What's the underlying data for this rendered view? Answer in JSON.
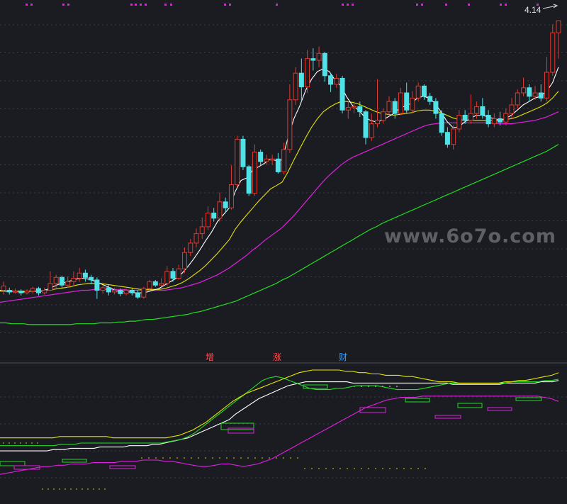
{
  "price_label": "4.14",
  "watermark": "www.6o7o.com",
  "signals": [
    "增",
    "涨",
    "财"
  ],
  "colors": {
    "background": "#1b1c22",
    "grid": "#3a3b46",
    "up": "#e0392e",
    "down": "#4fe3e8",
    "ma_short": "#ffffff",
    "ma_mid": "#e6e600",
    "ma_long": "#e020e0",
    "ma_longest": "#22dd22",
    "top_dots": "#e020e0"
  },
  "chart_data": {
    "type": "candlestick",
    "panel_top": {
      "ylim": [
        0.5,
        4.3
      ],
      "gridlines": 12,
      "candles": [
        [
          1.0,
          1.05,
          0.95,
          1.1
        ],
        [
          1.0,
          0.98,
          0.95,
          1.03
        ],
        [
          0.98,
          0.99,
          0.96,
          1.02
        ],
        [
          0.99,
          0.97,
          0.94,
          1.01
        ],
        [
          0.97,
          0.99,
          0.95,
          1.01
        ],
        [
          0.99,
          1.02,
          0.96,
          1.04
        ],
        [
          1.02,
          0.97,
          0.94,
          1.04
        ],
        [
          0.97,
          1.0,
          0.95,
          1.03
        ],
        [
          1.0,
          1.08,
          0.99,
          1.22
        ],
        [
          1.08,
          1.15,
          1.03,
          1.18
        ],
        [
          1.15,
          1.06,
          1.03,
          1.17
        ],
        [
          1.06,
          1.1,
          1.03,
          1.16
        ],
        [
          1.1,
          1.14,
          1.05,
          1.22
        ],
        [
          1.14,
          1.2,
          1.1,
          1.26
        ],
        [
          1.2,
          1.15,
          1.1,
          1.24
        ],
        [
          1.15,
          1.12,
          1.07,
          1.18
        ],
        [
          1.12,
          1.0,
          0.9,
          1.15
        ],
        [
          1.0,
          1.03,
          0.96,
          1.06
        ],
        [
          1.03,
          0.98,
          0.94,
          1.06
        ],
        [
          0.98,
          1.0,
          0.95,
          1.03
        ],
        [
          1.0,
          0.96,
          0.93,
          1.02
        ],
        [
          0.96,
          1.0,
          0.94,
          1.02
        ],
        [
          1.0,
          0.97,
          0.94,
          1.02
        ],
        [
          0.97,
          0.92,
          0.9,
          1.0
        ],
        [
          0.92,
          1.02,
          0.9,
          1.04
        ],
        [
          1.02,
          1.1,
          1.0,
          1.12
        ],
        [
          1.1,
          1.06,
          1.04,
          1.12
        ],
        [
          1.06,
          1.08,
          1.04,
          1.14
        ],
        [
          1.08,
          1.22,
          1.05,
          1.28
        ],
        [
          1.22,
          1.14,
          1.1,
          1.26
        ],
        [
          1.14,
          1.25,
          1.12,
          1.3
        ],
        [
          1.25,
          1.44,
          1.2,
          1.5
        ],
        [
          1.44,
          1.55,
          1.4,
          1.6
        ],
        [
          1.55,
          1.66,
          1.5,
          1.72
        ],
        [
          1.66,
          1.74,
          1.6,
          1.85
        ],
        [
          1.74,
          1.9,
          1.7,
          1.98
        ],
        [
          1.9,
          1.84,
          1.8,
          1.96
        ],
        [
          1.84,
          2.03,
          1.8,
          2.14
        ],
        [
          2.03,
          1.96,
          1.9,
          2.08
        ],
        [
          1.96,
          2.23,
          1.94,
          2.46
        ],
        [
          2.23,
          2.76,
          2.2,
          2.8
        ],
        [
          2.76,
          2.44,
          2.4,
          2.8
        ],
        [
          2.44,
          2.13,
          2.1,
          2.46
        ],
        [
          2.13,
          2.61,
          2.1,
          2.7
        ],
        [
          2.61,
          2.5,
          2.46,
          2.64
        ],
        [
          2.5,
          2.53,
          2.46,
          2.58
        ],
        [
          2.53,
          2.53,
          2.46,
          2.58
        ],
        [
          2.53,
          2.38,
          2.36,
          2.6
        ],
        [
          2.38,
          2.64,
          2.35,
          2.72
        ],
        [
          2.64,
          3.22,
          2.6,
          3.4
        ],
        [
          3.22,
          3.53,
          3.16,
          3.6
        ],
        [
          3.53,
          3.37,
          3.2,
          3.7
        ],
        [
          3.37,
          3.7,
          3.3,
          3.8
        ],
        [
          3.7,
          3.68,
          3.56,
          3.82
        ],
        [
          3.68,
          3.76,
          3.6,
          3.84
        ],
        [
          3.76,
          3.5,
          3.43,
          3.78
        ],
        [
          3.5,
          3.4,
          3.31,
          3.53
        ],
        [
          3.4,
          3.47,
          3.36,
          3.52
        ],
        [
          3.47,
          3.1,
          3.06,
          3.5
        ],
        [
          3.1,
          3.13,
          3.0,
          3.2
        ],
        [
          3.13,
          3.14,
          3.06,
          3.2
        ],
        [
          3.14,
          3.08,
          3.02,
          3.2
        ],
        [
          3.08,
          2.78,
          2.7,
          3.1
        ],
        [
          2.78,
          2.94,
          2.74,
          3.06
        ],
        [
          2.94,
          2.98,
          2.9,
          3.46
        ],
        [
          2.98,
          3.08,
          2.94,
          3.12
        ],
        [
          3.08,
          3.2,
          3.04,
          3.26
        ],
        [
          3.2,
          3.06,
          3.0,
          3.24
        ],
        [
          3.06,
          3.3,
          3.04,
          3.36
        ],
        [
          3.3,
          3.1,
          3.06,
          3.42
        ],
        [
          3.1,
          3.24,
          3.06,
          3.32
        ],
        [
          3.24,
          3.38,
          3.2,
          3.42
        ],
        [
          3.38,
          3.26,
          3.22,
          3.4
        ],
        [
          3.26,
          3.2,
          3.16,
          3.3
        ],
        [
          3.2,
          3.06,
          3.0,
          3.24
        ],
        [
          3.06,
          2.84,
          2.8,
          3.1
        ],
        [
          2.84,
          2.7,
          2.66,
          2.9
        ],
        [
          2.7,
          2.88,
          2.64,
          2.92
        ],
        [
          2.88,
          3.04,
          2.84,
          3.1
        ],
        [
          3.04,
          2.98,
          2.94,
          3.1
        ],
        [
          2.98,
          3.06,
          2.94,
          3.28
        ],
        [
          3.06,
          3.14,
          3.0,
          3.2
        ],
        [
          3.14,
          3.04,
          3.0,
          3.24
        ],
        [
          3.04,
          2.94,
          2.9,
          3.1
        ],
        [
          2.94,
          3.0,
          2.9,
          3.06
        ],
        [
          3.0,
          2.96,
          2.92,
          3.08
        ],
        [
          2.96,
          3.06,
          2.92,
          3.12
        ],
        [
          3.06,
          3.16,
          3.0,
          3.24
        ],
        [
          3.16,
          3.3,
          3.12,
          3.34
        ],
        [
          3.3,
          3.36,
          3.26,
          3.48
        ],
        [
          3.36,
          3.26,
          3.2,
          3.4
        ],
        [
          3.26,
          3.3,
          3.22,
          3.38
        ],
        [
          3.3,
          3.24,
          3.2,
          3.4
        ],
        [
          3.24,
          3.54,
          3.2,
          3.72
        ],
        [
          3.54,
          4.0,
          3.5,
          4.1
        ],
        [
          4.0,
          4.14,
          3.7,
          4.14
        ]
      ],
      "ma_short": [
        1.0,
        0.99,
        0.99,
        0.99,
        0.98,
        0.99,
        0.99,
        0.99,
        1.01,
        1.04,
        1.07,
        1.09,
        1.11,
        1.13,
        1.14,
        1.13,
        1.11,
        1.08,
        1.05,
        1.02,
        0.99,
        0.99,
        0.98,
        0.97,
        0.97,
        0.98,
        1.0,
        1.02,
        1.06,
        1.1,
        1.14,
        1.2,
        1.28,
        1.37,
        1.47,
        1.58,
        1.68,
        1.8,
        1.88,
        1.96,
        2.15,
        2.28,
        2.31,
        2.4,
        2.44,
        2.48,
        2.53,
        2.51,
        2.52,
        2.78,
        3.0,
        3.15,
        3.33,
        3.46,
        3.55,
        3.58,
        3.55,
        3.45,
        3.38,
        3.25,
        3.15,
        3.1,
        3.02,
        2.98,
        2.96,
        2.98,
        3.02,
        3.06,
        3.12,
        3.15,
        3.18,
        3.24,
        3.26,
        3.24,
        3.18,
        3.08,
        2.97,
        2.9,
        2.9,
        2.96,
        3.0,
        3.04,
        3.04,
        3.02,
        3.0,
        2.98,
        3.0,
        3.04,
        3.1,
        3.16,
        3.2,
        3.24,
        3.26,
        3.32,
        3.42,
        3.6
      ],
      "ma_mid": [
        0.99,
        0.99,
        0.99,
        0.99,
        0.99,
        0.99,
        0.99,
        0.99,
        1.0,
        1.01,
        1.02,
        1.03,
        1.04,
        1.06,
        1.07,
        1.08,
        1.08,
        1.08,
        1.07,
        1.06,
        1.05,
        1.04,
        1.03,
        1.02,
        1.01,
        1.01,
        1.01,
        1.01,
        1.02,
        1.04,
        1.06,
        1.09,
        1.13,
        1.18,
        1.23,
        1.29,
        1.36,
        1.43,
        1.51,
        1.59,
        1.71,
        1.8,
        1.88,
        1.96,
        2.04,
        2.11,
        2.18,
        2.22,
        2.26,
        2.38,
        2.52,
        2.65,
        2.78,
        2.9,
        3.0,
        3.08,
        3.13,
        3.17,
        3.2,
        3.2,
        3.19,
        3.17,
        3.14,
        3.11,
        3.08,
        3.06,
        3.05,
        3.04,
        3.05,
        3.06,
        3.07,
        3.09,
        3.1,
        3.1,
        3.09,
        3.07,
        3.04,
        3.01,
        2.99,
        2.98,
        2.98,
        2.98,
        2.98,
        2.98,
        2.98,
        2.98,
        2.99,
        3.0,
        3.02,
        3.05,
        3.08,
        3.11,
        3.14,
        3.18,
        3.24,
        3.32
      ],
      "ma_long": [
        0.86,
        0.87,
        0.88,
        0.89,
        0.9,
        0.91,
        0.92,
        0.93,
        0.94,
        0.95,
        0.96,
        0.97,
        0.98,
        0.99,
        1.0,
        1.0,
        1.01,
        1.01,
        1.01,
        1.01,
        1.01,
        1.01,
        1.0,
        1.0,
        1.0,
        1.0,
        1.0,
        1.0,
        1.0,
        1.01,
        1.02,
        1.03,
        1.05,
        1.07,
        1.09,
        1.12,
        1.15,
        1.18,
        1.22,
        1.26,
        1.31,
        1.36,
        1.41,
        1.47,
        1.52,
        1.58,
        1.63,
        1.68,
        1.73,
        1.8,
        1.87,
        1.95,
        2.03,
        2.11,
        2.19,
        2.27,
        2.34,
        2.4,
        2.46,
        2.51,
        2.55,
        2.58,
        2.61,
        2.64,
        2.67,
        2.7,
        2.73,
        2.76,
        2.79,
        2.82,
        2.85,
        2.88,
        2.91,
        2.93,
        2.94,
        2.95,
        2.95,
        2.95,
        2.95,
        2.95,
        2.95,
        2.95,
        2.95,
        2.95,
        2.95,
        2.94,
        2.94,
        2.94,
        2.95,
        2.96,
        2.97,
        2.98,
        3.0,
        3.02,
        3.05,
        3.08
      ],
      "ma_longest": [
        0.62,
        0.62,
        0.61,
        0.61,
        0.61,
        0.6,
        0.6,
        0.6,
        0.6,
        0.6,
        0.6,
        0.6,
        0.6,
        0.61,
        0.61,
        0.61,
        0.61,
        0.62,
        0.62,
        0.62,
        0.63,
        0.63,
        0.64,
        0.64,
        0.65,
        0.66,
        0.66,
        0.67,
        0.68,
        0.69,
        0.7,
        0.71,
        0.72,
        0.74,
        0.75,
        0.77,
        0.79,
        0.81,
        0.83,
        0.85,
        0.87,
        0.9,
        0.93,
        0.96,
        0.99,
        1.02,
        1.05,
        1.08,
        1.12,
        1.15,
        1.19,
        1.23,
        1.27,
        1.31,
        1.35,
        1.39,
        1.43,
        1.47,
        1.51,
        1.55,
        1.59,
        1.63,
        1.67,
        1.71,
        1.74,
        1.78,
        1.81,
        1.84,
        1.87,
        1.9,
        1.93,
        1.96,
        1.99,
        2.02,
        2.05,
        2.08,
        2.11,
        2.14,
        2.17,
        2.2,
        2.23,
        2.26,
        2.29,
        2.32,
        2.35,
        2.38,
        2.41,
        2.44,
        2.47,
        2.5,
        2.53,
        2.56,
        2.59,
        2.62,
        2.66,
        2.7
      ]
    },
    "panel_bottom": {
      "ylim": [
        0,
        100
      ],
      "gridlines": 4,
      "white": [
        38,
        38,
        38,
        38,
        38,
        38,
        38,
        38,
        38,
        39,
        39,
        39,
        40,
        40,
        40,
        40,
        40,
        41,
        41,
        41,
        41,
        41,
        42,
        42,
        42,
        42,
        43,
        43,
        44,
        45,
        46,
        47,
        48,
        50,
        52,
        54,
        56,
        58,
        60,
        62,
        66,
        69,
        72,
        75,
        78,
        80,
        82,
        84,
        86,
        88,
        89,
        90,
        91,
        91,
        91,
        91,
        91,
        91,
        91,
        91,
        90,
        90,
        90,
        90,
        90,
        90,
        90,
        90,
        90,
        90,
        90,
        90,
        90,
        90,
        90,
        90,
        90,
        89,
        89,
        89,
        89,
        89,
        89,
        89,
        89,
        89,
        90,
        90,
        90,
        90,
        90,
        90,
        91,
        91,
        91,
        92
      ],
      "yellow": [
        48,
        48,
        48,
        48,
        48,
        48,
        48,
        48,
        48,
        49,
        49,
        49,
        49,
        49,
        49,
        49,
        49,
        48,
        48,
        48,
        48,
        48,
        48,
        48,
        48,
        48,
        49,
        50,
        52,
        54,
        57,
        60,
        64,
        68,
        72,
        76,
        79,
        82,
        84,
        86,
        88,
        90,
        92,
        94,
        96,
        98,
        99,
        100,
        100,
        100,
        100,
        100,
        99,
        99,
        98,
        98,
        97,
        97,
        96,
        96,
        96,
        95,
        95,
        94,
        93,
        92,
        91,
        91,
        91,
        90,
        90,
        90,
        90,
        90,
        90,
        90,
        91,
        91,
        92,
        92,
        93,
        94,
        95,
        96,
        98
      ],
      "magenta": [
        20,
        21,
        22,
        23,
        24,
        25,
        26,
        26,
        27,
        27,
        28,
        28,
        28,
        29,
        29,
        29,
        29,
        30,
        30,
        30,
        31,
        31,
        31,
        30,
        30,
        29,
        28,
        27,
        26,
        26,
        27,
        28,
        28,
        27,
        26,
        27,
        28,
        30,
        32,
        35,
        38,
        41,
        44,
        47,
        50,
        53,
        56,
        59,
        62,
        65,
        68,
        71,
        73,
        75,
        77,
        78,
        79,
        79,
        79,
        80,
        80,
        80,
        80,
        80,
        80,
        80,
        80,
        80,
        80,
        80,
        80,
        80,
        80,
        80,
        80,
        80,
        79,
        78,
        76
      ],
      "green": [
        42,
        42,
        42,
        42,
        42,
        42,
        42,
        42,
        42,
        43,
        43,
        43,
        44,
        44,
        44,
        44,
        44,
        44,
        44,
        44,
        44,
        44,
        44,
        44,
        44,
        45,
        46,
        47,
        49,
        52,
        56,
        60,
        64,
        68,
        72,
        76,
        80,
        84,
        88,
        92,
        94,
        95,
        94,
        92,
        90,
        88,
        86,
        85,
        85,
        85,
        86,
        86,
        87,
        88,
        88,
        88,
        88,
        87,
        86,
        85,
        85,
        85,
        85,
        86,
        87,
        88,
        89,
        90,
        90,
        90,
        90,
        90,
        90,
        90,
        90,
        90,
        91,
        91,
        91,
        91,
        91,
        92,
        92,
        93
      ]
    }
  }
}
